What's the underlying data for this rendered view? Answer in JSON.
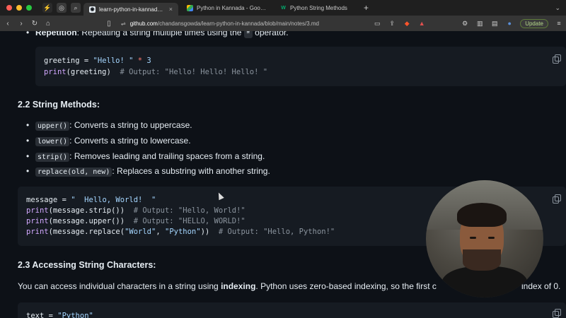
{
  "browser": {
    "tabs": [
      {
        "title": "learn-python-in-kannada/no",
        "active": true
      },
      {
        "title": "Python in Kannada - Google Drive",
        "active": false
      },
      {
        "title": "Python String Methods",
        "active": false
      }
    ],
    "url_host": "github.com",
    "url_path": "/chandansgowda/learn-python-in-kannada/blob/main/notes/3.md",
    "update_label": "Update"
  },
  "doc": {
    "repetition_title": "Repetition",
    "repetition_text": ": Repeating a string multiple times using the ",
    "repetition_op": "*",
    "repetition_end": " operator.",
    "code1": {
      "line1": {
        "a": "greeting = ",
        "b": "\"Hello! \"",
        "c": " * ",
        "d": "3"
      },
      "line2": {
        "a": "print",
        "b": "(greeting)  ",
        "c": "# Output: \"Hello! Hello! Hello! \""
      }
    },
    "section22": "2.2 String Methods:",
    "methods": [
      {
        "code": "upper()",
        "desc": ": Converts a string to uppercase."
      },
      {
        "code": "lower()",
        "desc": ": Converts a string to lowercase."
      },
      {
        "code": "strip()",
        "desc": ": Removes leading and trailing spaces from a string."
      },
      {
        "code": "replace(old, new)",
        "desc": ": Replaces a substring with another string."
      }
    ],
    "code2": {
      "l1": {
        "a": "message = ",
        "b": "\"  Hello, World!  \""
      },
      "l2": {
        "a": "print",
        "b": "(message.strip())  ",
        "c": "# Output: \"Hello, World!\""
      },
      "l3": {
        "a": "print",
        "b": "(message.upper())  ",
        "c": "# Output: \"HELLO, WORLD!\""
      },
      "l4": {
        "a": "print",
        "b": "(message.replace(",
        "c": "\"World\"",
        "d": ", ",
        "e": "\"Python\"",
        "f": "))  ",
        "g": "# Output: \"Hello, Python!\""
      }
    },
    "section23": "2.3 Accessing String Characters:",
    "index_text_a": "You can access individual characters in a string using ",
    "index_text_b": "indexing",
    "index_text_c": ". Python uses zero-based indexing, so the first c",
    "index_text_d": "index of 0.",
    "code3": {
      "a": "text = ",
      "b": "\"Python\""
    }
  },
  "colors": {
    "page_bg": "#0d1117",
    "code_bg": "#161b22",
    "string": "#a5d6ff",
    "keyword": "#ff7b72",
    "function": "#d2a8ff",
    "comment": "#8b949e"
  },
  "icons": [
    "apple-close",
    "copy-icon",
    "back-icon",
    "forward-icon",
    "reload-icon",
    "home-icon",
    "bookmark-icon",
    "share-icon",
    "brave-shield-icon",
    "extensions-icon",
    "sidebar-icon"
  ]
}
